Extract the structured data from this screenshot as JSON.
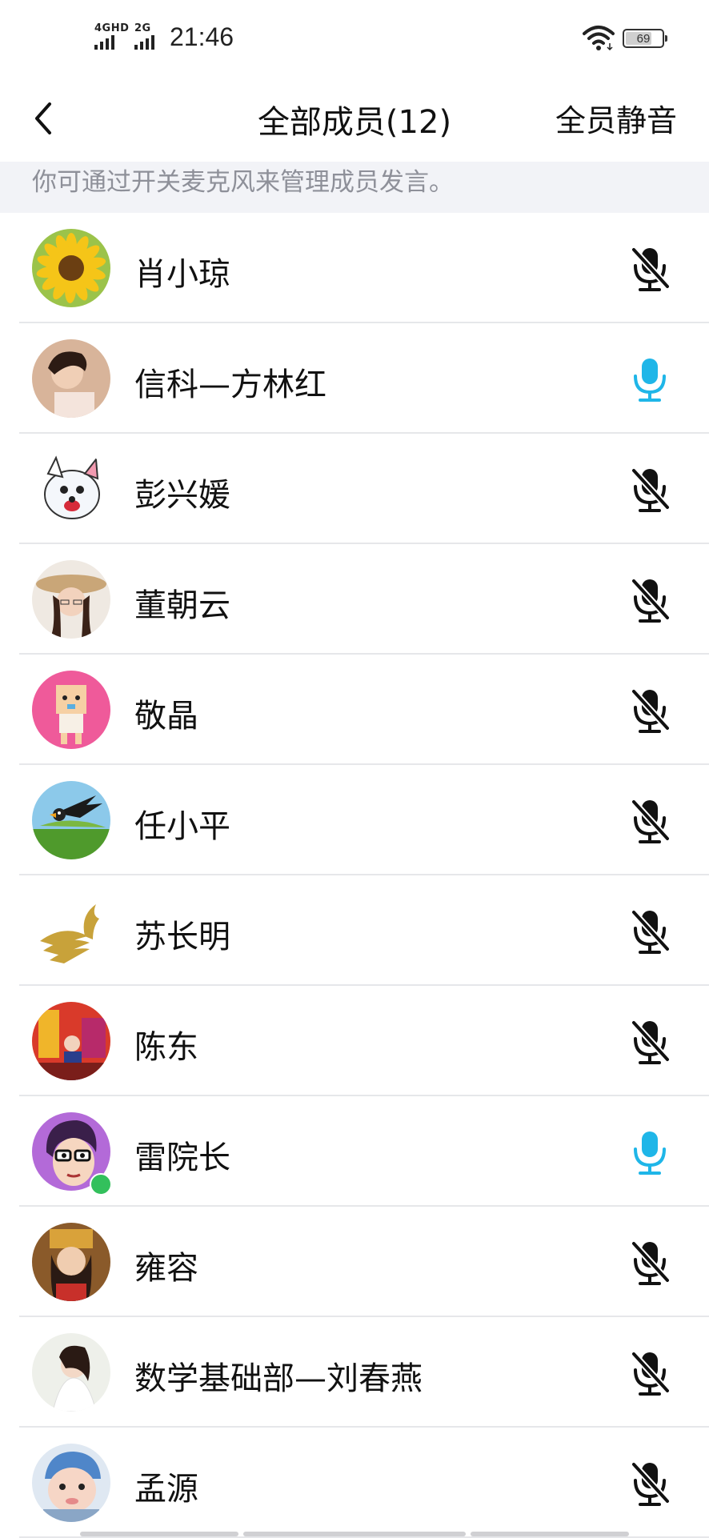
{
  "status_bar": {
    "network_1": "4GHD",
    "network_2": "2G",
    "time": "21:46",
    "battery": "69",
    "wifi_icon": "wifi-icon"
  },
  "header": {
    "back_icon": "chevron-left-icon",
    "title": "全部成员(12)",
    "mute_all_label": "全员静音"
  },
  "notice": "你可通过开关麦克风来管理成员发言。",
  "colors": {
    "mic_on": "#1fb6e8",
    "mic_off": "#111111",
    "divider": "#e6e7ea",
    "notice_bg": "#f2f3f7"
  },
  "members": [
    {
      "name": "肖小琼",
      "mic": "off",
      "avatar": "sunflower"
    },
    {
      "name": "信科—方林红",
      "mic": "on",
      "avatar": "woman-photo"
    },
    {
      "name": "彭兴媛",
      "mic": "off",
      "avatar": "cartoon-dog"
    },
    {
      "name": "董朝云",
      "mic": "off",
      "avatar": "woman-hat"
    },
    {
      "name": "敬晶",
      "mic": "off",
      "avatar": "pink-cartoon"
    },
    {
      "name": "任小平",
      "mic": "off",
      "avatar": "bird-landscape"
    },
    {
      "name": "苏长明",
      "mic": "off",
      "avatar": "gold-phoenix"
    },
    {
      "name": "陈东",
      "mic": "off",
      "avatar": "festival-photo"
    },
    {
      "name": "雷院长",
      "mic": "on",
      "avatar": "cartoon-man-glasses",
      "speaking_badge": true
    },
    {
      "name": "雍容",
      "mic": "off",
      "avatar": "costume-woman"
    },
    {
      "name": "数学基础部—刘春燕",
      "mic": "off",
      "avatar": "bride-photo"
    },
    {
      "name": "孟源",
      "mic": "off",
      "avatar": "baby-photo"
    }
  ]
}
